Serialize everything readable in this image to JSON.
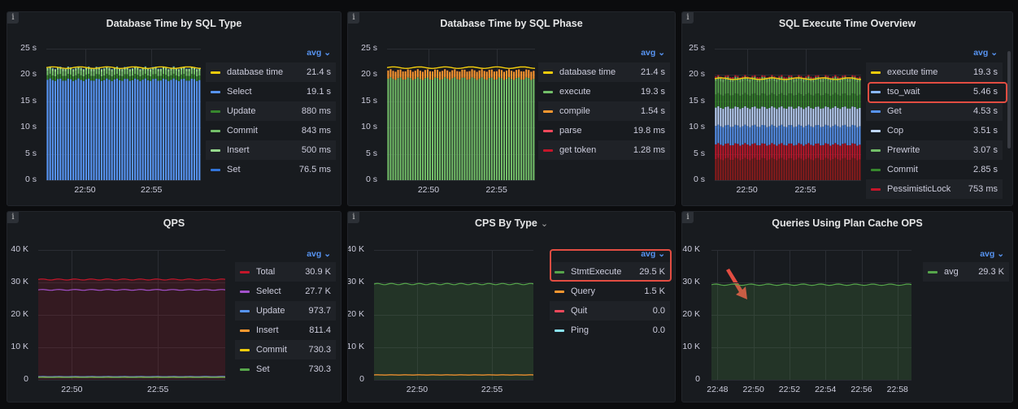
{
  "panels": [
    {
      "title": "Database Time by SQL Type",
      "yticks": [
        "25 s",
        "20 s",
        "15 s",
        "10 s",
        "5 s",
        "0 s"
      ],
      "xticks": [
        "22:50",
        "22:55"
      ],
      "legend_sort": "avg ⌄",
      "legend": [
        {
          "name": "database time",
          "value": "21.4 s",
          "color": "#f2cc0c"
        },
        {
          "name": "Select",
          "value": "19.1 s",
          "color": "#5794f2"
        },
        {
          "name": "Update",
          "value": "880 ms",
          "color": "#37872d"
        },
        {
          "name": "Commit",
          "value": "843 ms",
          "color": "#73bf69"
        },
        {
          "name": "Insert",
          "value": "500 ms",
          "color": "#96d98d"
        },
        {
          "name": "Set",
          "value": "76.5 ms",
          "color": "#3274d9"
        }
      ]
    },
    {
      "title": "Database Time by SQL Phase",
      "yticks": [
        "25 s",
        "20 s",
        "15 s",
        "10 s",
        "5 s",
        "0 s"
      ],
      "xticks": [
        "22:50",
        "22:55"
      ],
      "legend_sort": "avg ⌄",
      "legend": [
        {
          "name": "database time",
          "value": "21.4 s",
          "color": "#f2cc0c"
        },
        {
          "name": "execute",
          "value": "19.3 s",
          "color": "#73bf69"
        },
        {
          "name": "compile",
          "value": "1.54 s",
          "color": "#ff9830"
        },
        {
          "name": "parse",
          "value": "19.8 ms",
          "color": "#f2495c"
        },
        {
          "name": "get token",
          "value": "1.28 ms",
          "color": "#c4162a"
        }
      ]
    },
    {
      "title": "SQL Execute Time Overview",
      "yticks": [
        "25 s",
        "20 s",
        "15 s",
        "10 s",
        "5 s",
        "0 s"
      ],
      "xticks": [
        "22:50",
        "22:55"
      ],
      "legend_sort": "avg ⌄",
      "legend": [
        {
          "name": "execute time",
          "value": "19.3 s",
          "color": "#f2cc0c"
        },
        {
          "name": "tso_wait",
          "value": "5.46 s",
          "color": "#8ab8ff"
        },
        {
          "name": "Get",
          "value": "4.53 s",
          "color": "#5794f2"
        },
        {
          "name": "Cop",
          "value": "3.51 s",
          "color": "#c0d8ff"
        },
        {
          "name": "Prewrite",
          "value": "3.07 s",
          "color": "#73bf69"
        },
        {
          "name": "Commit",
          "value": "2.85 s",
          "color": "#37872d"
        },
        {
          "name": "PessimisticLock",
          "value": "753 ms",
          "color": "#c4162a"
        }
      ]
    },
    {
      "title": "QPS",
      "yticks": [
        "40 K",
        "30 K",
        "20 K",
        "10 K",
        "0"
      ],
      "xticks": [
        "22:50",
        "22:55"
      ],
      "legend_sort": "avg ⌄",
      "legend": [
        {
          "name": "Total",
          "value": "30.9 K",
          "color": "#c4162a"
        },
        {
          "name": "Select",
          "value": "27.7 K",
          "color": "#a352cc"
        },
        {
          "name": "Update",
          "value": "973.7",
          "color": "#5794f2"
        },
        {
          "name": "Insert",
          "value": "811.4",
          "color": "#ff9830"
        },
        {
          "name": "Commit",
          "value": "730.3",
          "color": "#f2cc0c"
        },
        {
          "name": "Set",
          "value": "730.3",
          "color": "#56a64b"
        }
      ]
    },
    {
      "title": "CPS By Type",
      "title_chevron": "⌄",
      "yticks": [
        "40 K",
        "30 K",
        "20 K",
        "10 K",
        "0"
      ],
      "xticks": [
        "22:50",
        "22:55"
      ],
      "legend_sort": "avg ⌄",
      "legend": [
        {
          "name": "StmtExecute",
          "value": "29.5 K",
          "color": "#56a64b"
        },
        {
          "name": "Query",
          "value": "1.5 K",
          "color": "#ff9830"
        },
        {
          "name": "Quit",
          "value": "0.0",
          "color": "#f2495c"
        },
        {
          "name": "Ping",
          "value": "0.0",
          "color": "#8ae3f5"
        }
      ]
    },
    {
      "title": "Queries Using Plan Cache OPS",
      "yticks": [
        "40 K",
        "30 K",
        "20 K",
        "10 K",
        "0"
      ],
      "xticks": [
        "22:48",
        "22:50",
        "22:52",
        "22:54",
        "22:56",
        "22:58"
      ],
      "legend_sort": "avg ⌄",
      "legend": [
        {
          "name": "avg",
          "value": "29.3 K",
          "color": "#56a64b"
        }
      ]
    }
  ]
}
